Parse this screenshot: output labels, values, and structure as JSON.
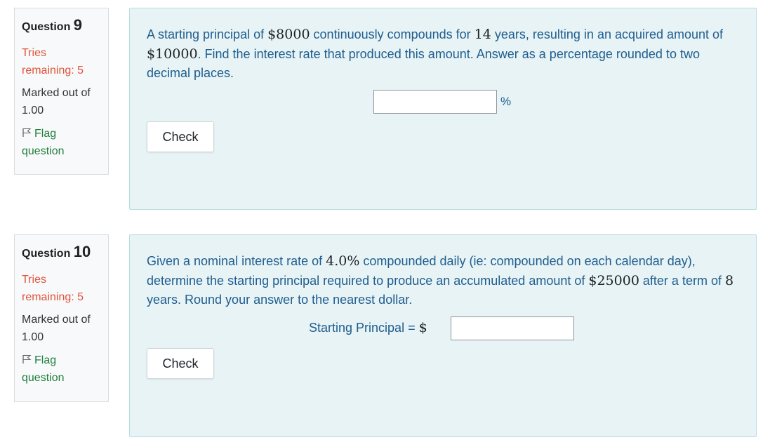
{
  "questions": [
    {
      "label": "Question",
      "number": "9",
      "tries": "Tries remaining: 5",
      "marked_line1": "Marked out of",
      "marked_line2": "1.00",
      "flag_line1": "Flag",
      "flag_line2": "question",
      "text": {
        "p1": "A starting principal of ",
        "m1": "$8000",
        "p2": " continuously compounds for ",
        "m2": "14",
        "p3": " years, resulting in an acquired amount of ",
        "m3": "$10000",
        "p4": ". Find the interest rate that produced this amount. Answer as a percentage rounded to two decimal places."
      },
      "answer_prefix": "",
      "answer_suffix": "%",
      "answer_value": "",
      "check_label": "Check"
    },
    {
      "label": "Question",
      "number": "10",
      "tries": "Tries remaining: 5",
      "marked_line1": "Marked out of",
      "marked_line2": "1.00",
      "flag_line1": "Flag",
      "flag_line2": "question",
      "text": {
        "p1": "Given a nominal interest rate of ",
        "m1": "4.0%",
        "p2": " compounded daily (ie: compounded on each calendar day), determine the starting principal required to produce an accumulated amount of ",
        "m2": "$25000",
        "p3": " after a term of ",
        "m3": "8",
        "p4": " years. Round your answer to the nearest dollar."
      },
      "answer_prefix": "Starting Principal = ",
      "answer_prefix_math": "$",
      "answer_suffix": "",
      "answer_value": "",
      "check_label": "Check"
    }
  ],
  "colors": {
    "tries": "#e0533a",
    "flag": "#1f7e3d",
    "question_text": "#1f5d8f",
    "content_bg": "#e7f3f5"
  },
  "icons": {
    "flag": "flag-icon"
  }
}
